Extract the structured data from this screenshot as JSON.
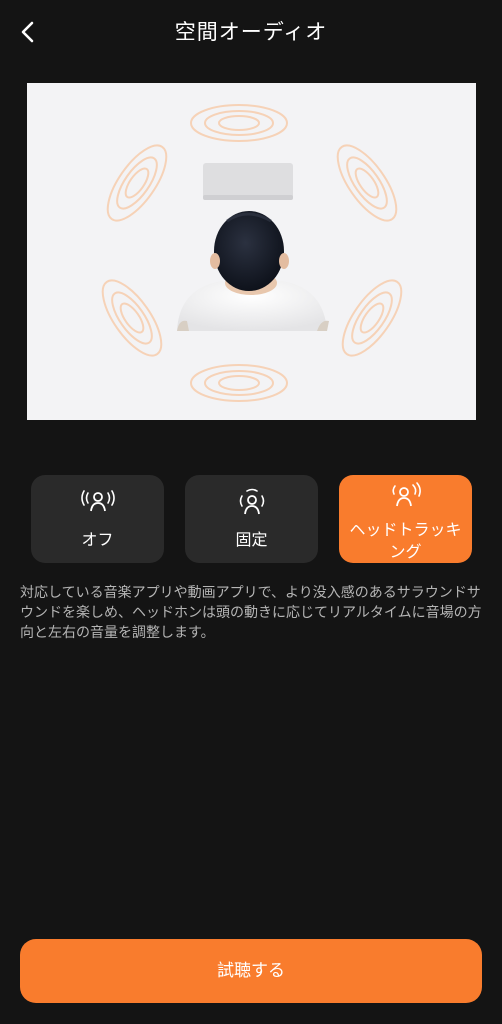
{
  "header": {
    "back_icon": "chevron-left-icon",
    "title": "空間オーディオ"
  },
  "illustration": {
    "description_icon": "listener-with-surround-speakers",
    "accent_color": "#f97c2d"
  },
  "modes": {
    "selected": "head_tracking",
    "items": [
      {
        "id": "off",
        "label": "オフ",
        "icon": "sound-waves-person-icon"
      },
      {
        "id": "fixed",
        "label": "固定",
        "icon": "fixed-sound-person-icon"
      },
      {
        "id": "head_tracking",
        "label": "ヘッドトラッキング",
        "icon": "head-tracking-person-icon"
      }
    ]
  },
  "description": {
    "text": "対応している音楽アプリや動画アプリで、より没入感のあるサラウンドサウンドを楽しめ、ヘッドホンは頭の動きに応じてリアルタイムに音場の方向と左右の音量を調整します。"
  },
  "footer": {
    "trial_label": "試聴する"
  },
  "colors": {
    "background": "#141414",
    "card": "#2a2a2a",
    "accent": "#f97c2d",
    "text_secondary": "#b5b5b5"
  }
}
